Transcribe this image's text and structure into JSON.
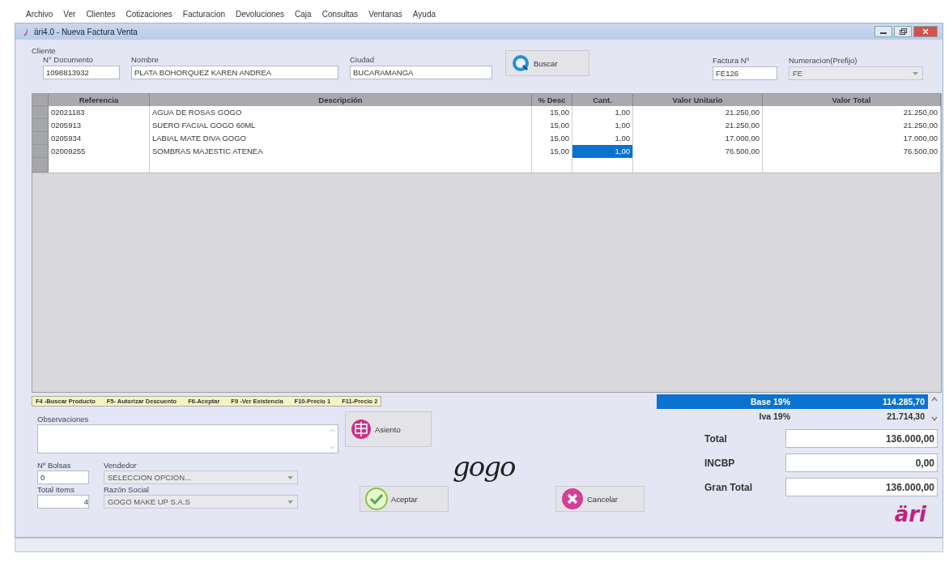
{
  "menu": [
    "Archivo",
    "Ver",
    "Clientes",
    "Cotizaciones",
    "Facturacion",
    "Devoluciones",
    "Caja",
    "Consultas",
    "Ventanas",
    "Ayuda"
  ],
  "window": {
    "title": "äri4.0 - Nueva Factura Venta"
  },
  "cliente": {
    "group_label": "Cliente",
    "documento": {
      "label": "N° Documento",
      "value": "1098813932"
    },
    "nombre": {
      "label": "Nombre",
      "value": "PLATA BOHORQUEZ KAREN ANDREA"
    },
    "ciudad": {
      "label": "Ciudad",
      "value": "BUCARAMANGA"
    },
    "buscar": "Buscar"
  },
  "factura": {
    "label": "Factura Nº",
    "value": "FE126"
  },
  "numeracion": {
    "label": "Numeracion(Prefijo)",
    "value": "FE"
  },
  "table": {
    "columns": [
      "Referencia",
      "Descripción",
      "% Desc",
      "Cant.",
      "Valor Unitario",
      "Valor Total"
    ],
    "rows": [
      {
        "cells": [
          "02021183",
          "AGUA DE ROSAS GOGO",
          "15,00",
          "1,00",
          "21.250,00",
          "21.250,00"
        ],
        "cant_selected": false
      },
      {
        "cells": [
          "0205913",
          "SUERO FACIAL GOGO 60ML",
          "15,00",
          "1,00",
          "21.250,00",
          "21.250,00"
        ],
        "cant_selected": false
      },
      {
        "cells": [
          "0205934",
          "LABIAL MATE DIVA GOGO",
          "15,00",
          "1,00",
          "17.000,00",
          "17.000,00"
        ],
        "cant_selected": false
      },
      {
        "cells": [
          "02009255",
          "SOMBRAS MAJESTIC ATENEA",
          "15,00",
          "1,00",
          "76.500,00",
          "76.500,00"
        ],
        "cant_selected": true
      }
    ]
  },
  "shortcuts": [
    "F4 -Buscar Producto",
    "F5- Autorizar Descuento",
    "F6-Aceptar",
    "F9 -Ver Existencia",
    "F10-Precio 1",
    "F11-Precio 2"
  ],
  "observaciones": {
    "label": "Observaciones"
  },
  "bolsas": {
    "label": "Nº Bolsas",
    "value": "0"
  },
  "vendedor": {
    "label": "Vendedor",
    "value": "SELECCION OPCION..."
  },
  "total_items": {
    "label": "Total Items",
    "value": "4"
  },
  "razon_social": {
    "label": "Razón Social",
    "value": "GOGO MAKE UP S.A.S"
  },
  "asiento": "Asiento",
  "brand_logo": "gogo",
  "aceptar": "Aceptar",
  "cancelar": "Cancelar",
  "taxes": [
    {
      "label": "Base 19%",
      "value": "114.285,70",
      "selected": true
    },
    {
      "label": "Iva 19%",
      "value": "21.714,30",
      "selected": false
    }
  ],
  "totals": [
    {
      "label": "Total",
      "value": "136.000,00"
    },
    {
      "label": "INCBP",
      "value": "0,00"
    },
    {
      "label": "Gran Total",
      "value": "136.000,00"
    }
  ],
  "vendor_logo": "äri"
}
